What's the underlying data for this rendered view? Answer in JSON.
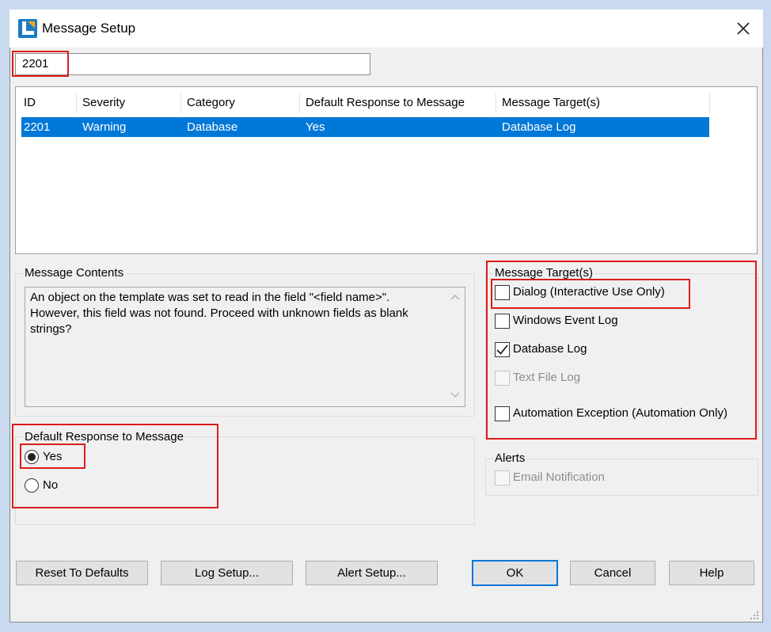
{
  "window": {
    "title": "Message Setup",
    "app_icon": "app-logo-icon",
    "close_icon": "close-icon"
  },
  "search": {
    "value": "2201"
  },
  "table": {
    "columns": [
      "ID",
      "Severity",
      "Category",
      "Default Response to Message",
      "Message Target(s)"
    ],
    "rows": [
      {
        "id": "2201",
        "severity": "Warning",
        "category": "Database",
        "default_response": "Yes",
        "targets": "Database Log",
        "selected": true
      }
    ]
  },
  "message_contents": {
    "title": "Message Contents",
    "text": "An object on the template was set to read in the field \"<field name>\".  However, this field was not found.  Proceed with unknown fields as blank strings?"
  },
  "message_targets": {
    "title": "Message Target(s)",
    "options": [
      {
        "label": "Dialog (Interactive Use Only)",
        "checked": false,
        "enabled": true
      },
      {
        "label": "Windows Event Log",
        "checked": false,
        "enabled": true
      },
      {
        "label": "Database Log",
        "checked": true,
        "enabled": true
      },
      {
        "label": "Text File Log",
        "checked": false,
        "enabled": false
      },
      {
        "label": "Automation Exception (Automation Only)",
        "checked": false,
        "enabled": true
      }
    ]
  },
  "default_response": {
    "title": "Default Response to Message",
    "options": [
      {
        "label": "Yes",
        "selected": true
      },
      {
        "label": "No",
        "selected": false
      }
    ]
  },
  "alerts": {
    "title": "Alerts",
    "options": [
      {
        "label": "Email Notification",
        "checked": false,
        "enabled": false
      }
    ]
  },
  "buttons": {
    "reset": "Reset To Defaults",
    "log_setup": "Log Setup...",
    "alert_setup": "Alert Setup...",
    "ok": "OK",
    "cancel": "Cancel",
    "help": "Help"
  },
  "colors": {
    "selection": "#0078d7",
    "annotation_highlight": "#dd1c1c",
    "window_bg": "#f0f0f0"
  }
}
